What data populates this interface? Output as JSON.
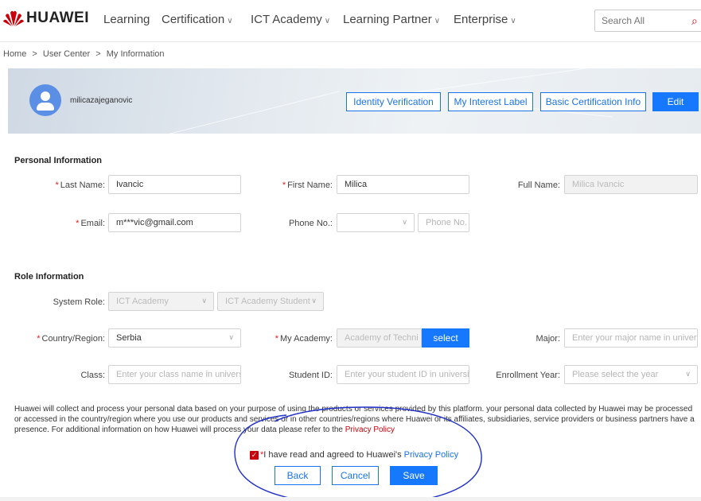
{
  "header": {
    "brand": "HUAWEI",
    "nav": [
      {
        "label": "Learning",
        "has_dropdown": false
      },
      {
        "label": "Certification",
        "has_dropdown": true
      },
      {
        "label": "ICT Academy",
        "has_dropdown": true
      },
      {
        "label": "Learning Partner",
        "has_dropdown": true
      },
      {
        "label": "Enterprise",
        "has_dropdown": true
      }
    ],
    "search_placeholder": "Search All",
    "accent_color": "#c7000b"
  },
  "breadcrumb": [
    "Home",
    ">",
    "User Center",
    ">",
    "My Information"
  ],
  "profile": {
    "username": "milicazajeganovic",
    "buttons": {
      "identity": "Identity Verification",
      "interest": "My Interest Label",
      "basic_cert": "Basic Certification Info",
      "edit": "Edit"
    }
  },
  "personal": {
    "title": "Personal Information",
    "last_name_label": "Last Name:",
    "last_name": "Ivancic",
    "first_name_label": "First Name:",
    "first_name": "Milica",
    "full_name_label": "Full Name:",
    "full_name": "Milica Ivancic",
    "email_label": "Email:",
    "email": "m***vic@gmail.com",
    "phone_label": "Phone No.:",
    "phone_placeholder": "Phone No."
  },
  "role": {
    "title": "Role Information",
    "system_role_label": "System Role:",
    "system_role": "ICT Academy",
    "system_subrole": "ICT Academy Student",
    "country_label": "Country/Region:",
    "country": "Serbia",
    "academy_label": "My Academy:",
    "academy": "Academy of Techni",
    "select_button": "select",
    "major_label": "Major:",
    "major_placeholder": "Enter your major name in univer",
    "class_label": "Class:",
    "class_placeholder": "Enter your class name in universi",
    "student_id_label": "Student ID:",
    "student_id_placeholder": "Enter your student ID in universi",
    "enrollment_label": "Enrollment Year:",
    "enrollment_placeholder": "Please select the year"
  },
  "notice": {
    "text": "Huawei will collect and process your personal data based on your purpose of using the products or services provided by this platform. your personal data collected by Huawei may be processed or accessed in the country/region where you use our products and services or in other countries/regions where Huawei or its affiliates, subsidiaries, service providers or business partners have a presence. For additional information on how Huawei will process your data please refer to the",
    "link": "Privacy Policy"
  },
  "agreement": {
    "checked": true,
    "text": "I have read and agreed to Huawei's",
    "link": "Privacy Policy"
  },
  "actions": {
    "back": "Back",
    "cancel": "Cancel",
    "save": "Save"
  },
  "annotation_color": "#2030c8"
}
